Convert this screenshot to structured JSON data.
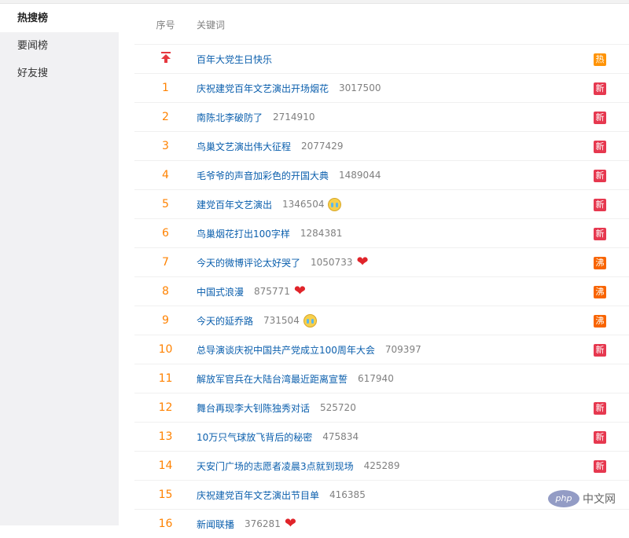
{
  "sidebar": {
    "items": [
      {
        "label": "热搜榜",
        "active": true
      },
      {
        "label": "要闻榜",
        "active": false
      },
      {
        "label": "好友搜",
        "active": false
      }
    ]
  },
  "table": {
    "headers": {
      "rank": "序号",
      "keyword": "关键词"
    },
    "rows": [
      {
        "rank": "",
        "pinned": true,
        "keyword": "百年大党生日快乐",
        "count": "",
        "emoji": "",
        "badge": "热"
      },
      {
        "rank": "1",
        "keyword": "庆祝建党百年文艺演出开场烟花",
        "count": "3017500",
        "emoji": "",
        "badge": "新"
      },
      {
        "rank": "2",
        "keyword": "南陈北李破防了",
        "count": "2714910",
        "emoji": "",
        "badge": "新"
      },
      {
        "rank": "3",
        "keyword": "鸟巢文艺演出伟大征程",
        "count": "2077429",
        "emoji": "",
        "badge": "新"
      },
      {
        "rank": "4",
        "keyword": "毛爷爷的声音加彩色的开国大典",
        "count": "1489044",
        "emoji": "",
        "badge": "新"
      },
      {
        "rank": "5",
        "keyword": "建党百年文艺演出",
        "count": "1346504",
        "emoji": "cry",
        "badge": "新"
      },
      {
        "rank": "6",
        "keyword": "鸟巢烟花打出100字样",
        "count": "1284381",
        "emoji": "",
        "badge": "新"
      },
      {
        "rank": "7",
        "keyword": "今天的微博评论太好哭了",
        "count": "1050733",
        "emoji": "heart",
        "badge": "沸"
      },
      {
        "rank": "8",
        "keyword": "中国式浪漫",
        "count": "875771",
        "emoji": "heart",
        "badge": "沸"
      },
      {
        "rank": "9",
        "keyword": "今天的延乔路",
        "count": "731504",
        "emoji": "cry",
        "badge": "沸"
      },
      {
        "rank": "10",
        "keyword": "总导演谈庆祝中国共产党成立100周年大会",
        "count": "709397",
        "emoji": "",
        "badge": "新"
      },
      {
        "rank": "11",
        "keyword": "解放军官兵在大陆台湾最近距离宣誓",
        "count": "617940",
        "emoji": "",
        "badge": ""
      },
      {
        "rank": "12",
        "keyword": "舞台再现李大钊陈独秀对话",
        "count": "525720",
        "emoji": "",
        "badge": "新"
      },
      {
        "rank": "13",
        "keyword": "10万只气球放飞背后的秘密",
        "count": "475834",
        "emoji": "",
        "badge": "新"
      },
      {
        "rank": "14",
        "keyword": "天安门广场的志愿者凌晨3点就到现场",
        "count": "425289",
        "emoji": "",
        "badge": "新"
      },
      {
        "rank": "15",
        "keyword": "庆祝建党百年文艺演出节目单",
        "count": "416385",
        "emoji": "",
        "badge": ""
      },
      {
        "rank": "16",
        "keyword": "新闻联播",
        "count": "376281",
        "emoji": "heart",
        "badge": ""
      }
    ]
  },
  "watermark": {
    "logo": "php",
    "text": "中文网"
  },
  "colors": {
    "rank": "#ff8200",
    "link": "#0b5fad",
    "badge_new": "#e6384f",
    "badge_boil": "#f86400",
    "badge_hot": "#ff9406",
    "sidebar_bg": "#f1f1f3"
  }
}
